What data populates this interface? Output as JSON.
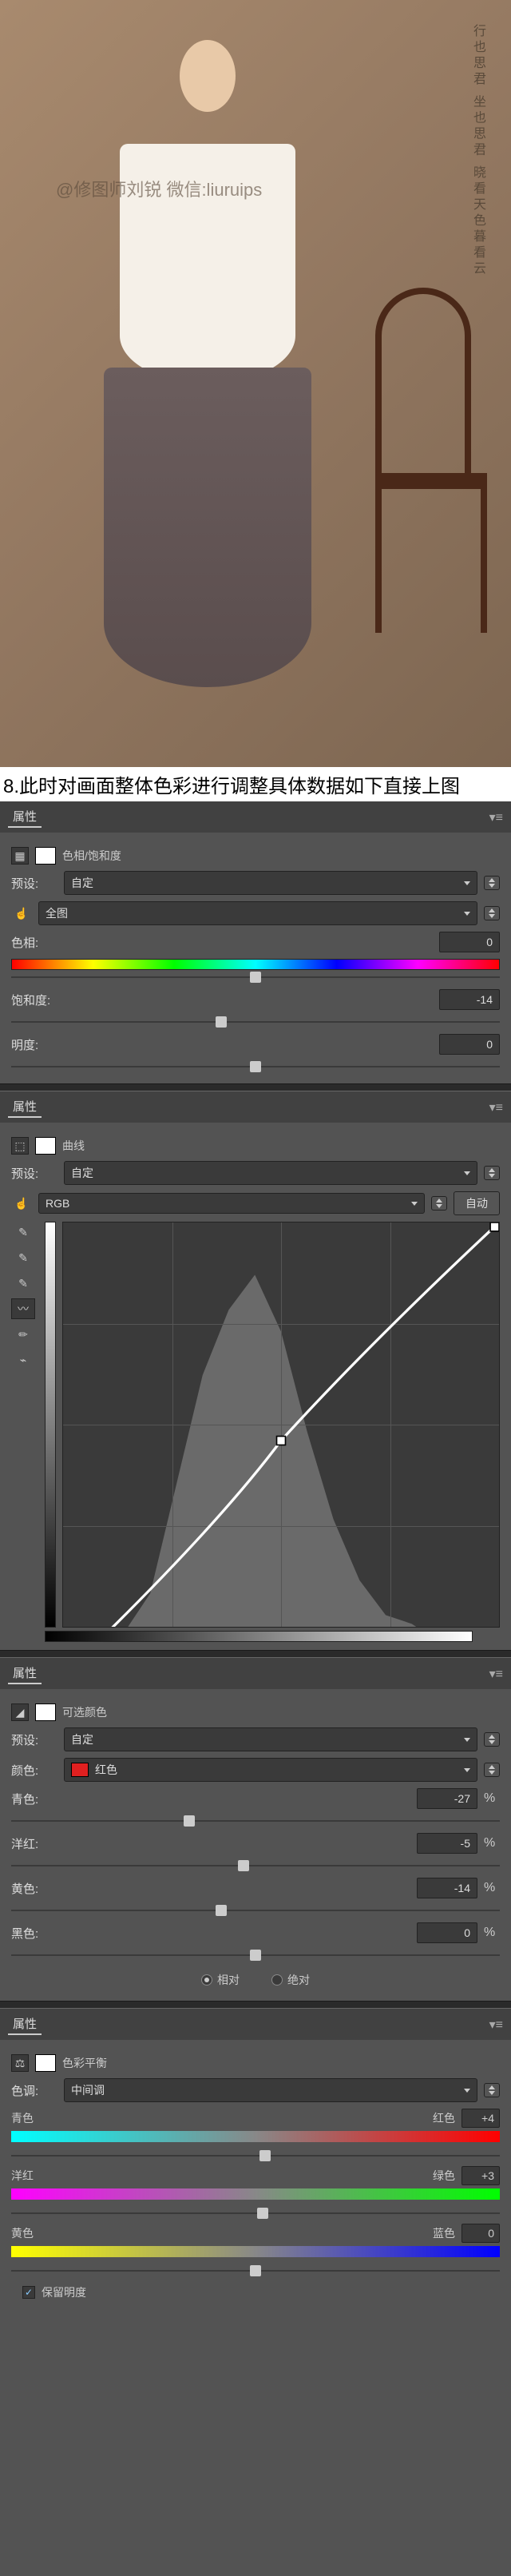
{
  "hero": {
    "watermark": "@修图师刘锐 微信:liuruips",
    "text_vert": "行也思君 坐也思君\n晓看天色暮看云"
  },
  "caption": "8.此时对画面整体色彩进行调整具体数据如下直接上图",
  "panels": {
    "properties_label": "属性",
    "hue_sat": {
      "title": "色相/饱和度",
      "preset_label": "预设:",
      "preset_value": "自定",
      "channel_value": "全图",
      "hue_label": "色相:",
      "hue_value": "0",
      "sat_label": "饱和度:",
      "sat_value": "-14",
      "light_label": "明度:",
      "light_value": "0"
    },
    "curves": {
      "title": "曲线",
      "preset_label": "预设:",
      "preset_value": "自定",
      "channel_value": "RGB",
      "auto_label": "自动"
    },
    "selective": {
      "title": "可选颜色",
      "preset_label": "预设:",
      "preset_value": "自定",
      "color_label": "颜色:",
      "color_value": "红色",
      "cyan_label": "青色:",
      "cyan_value": "-27",
      "magenta_label": "洋红:",
      "magenta_value": "-5",
      "yellow_label": "黄色:",
      "yellow_value": "-14",
      "black_label": "黑色:",
      "black_value": "0",
      "relative_label": "相对",
      "absolute_label": "绝对"
    },
    "color_balance": {
      "title": "色彩平衡",
      "tone_label": "色调:",
      "tone_value": "中间调",
      "cyan_label": "青色",
      "red_label": "红色",
      "cr_value": "+4",
      "magenta_label": "洋红",
      "green_label": "绿色",
      "mg_value": "+3",
      "yellow_label": "黄色",
      "blue_label": "蓝色",
      "yb_value": "0",
      "preserve_label": "保留明度"
    }
  }
}
